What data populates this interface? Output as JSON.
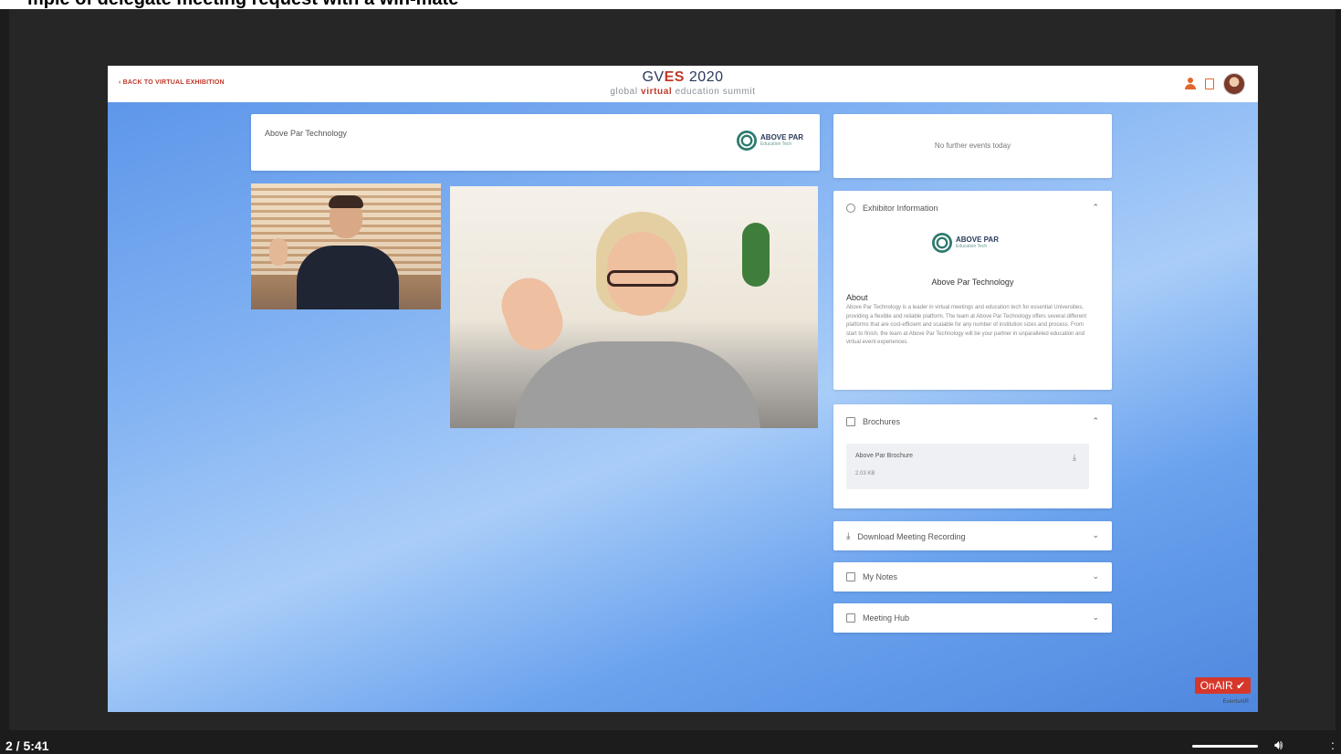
{
  "caption": "mple of delegate meeting request with a win-mate",
  "topbar": {
    "back_label": "‹ BACK TO VIRTUAL EXHIBITION",
    "brand_prefix": "GV",
    "brand_accent": "ES",
    "brand_year": " 2020",
    "brand_sub_1": "global ",
    "brand_sub_accent": "virtual",
    "brand_sub_2": " education summit"
  },
  "exhibitor": {
    "name": "Above Par Technology",
    "logo_text": "ABOVE PAR",
    "logo_sub": "Education Tech"
  },
  "events": {
    "text": "No further events today"
  },
  "info": {
    "title": "Exhibitor Information",
    "company": "Above Par Technology",
    "about_label": "About",
    "about_text": "Above Par Technology is a leader in virtual meetings and education tech for essential Universities, providing a flexible and reliable platform. The team at Above Par Technology offers several different platforms that are cost-efficient and scalable for any number of institution sizes and process. From start to finish, the team at Above Par Technology will be your partner in unparalleled education and virtual event experiences."
  },
  "brochures": {
    "title": "Brochures",
    "item_name": "Above Par Brochure",
    "item_size": "2.03 KB"
  },
  "rows": {
    "download": "Download Meeting Recording",
    "notes": "My Notes",
    "hub": "Meeting Hub"
  },
  "onair": {
    "label": "OnAIR",
    "sub": "EventsAIR"
  },
  "player": {
    "time": "2 / 5:41",
    "edge": ":"
  },
  "colors": {
    "accent": "#c0392b",
    "brand": "#2a3a5c",
    "logo": "#2d7a6e"
  }
}
